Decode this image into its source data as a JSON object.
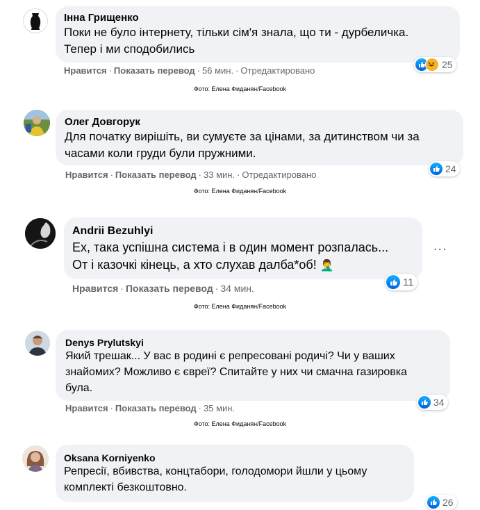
{
  "photo_credit": "Фото: Елена Фиданян/Facebook",
  "actions": {
    "like": "Нравится",
    "translate": "Показать перевод"
  },
  "comments": [
    {
      "author": "Інна Грищенко",
      "lines": [
        "Поки не було інтернету, тільки сім'я знала, що ти - дурбеличка.",
        "Тепер і ми сподобились"
      ],
      "time": "56 мин.",
      "edited": "Отредактировано",
      "reactions": [
        "like-icon",
        "haha-icon"
      ],
      "reaction_count": "25"
    },
    {
      "author": "Олег Довгорук",
      "lines": [
        "Для початку вирішіть, ви сумуєте за цінами, за дитинством чи за",
        "часами коли груди були пружними."
      ],
      "time": "33 мин.",
      "edited": "Отредактировано",
      "reactions": [
        "like-icon"
      ],
      "reaction_count": "24"
    },
    {
      "author": "Andrii Bezuhlyi",
      "lines": [
        "Ех, така успішна система і в один момент розпалась...",
        "От і казочкі кінець, а хто слухав далба*об!"
      ],
      "emoji": "🤦‍♂️",
      "time": "34 мин.",
      "reactions": [
        "like-icon"
      ],
      "reaction_count": "11",
      "more": "..."
    },
    {
      "author": "Denys Prylutskyi",
      "lines": [
        "Який трешак... У вас в родині є репресовані родичі? Чи у ваших",
        "знайомих? Можливо є євреї? Спитайте у них чи смачна газировка",
        "була."
      ],
      "time": "35 мин.",
      "reactions": [
        "like-icon"
      ],
      "reaction_count": "34"
    },
    {
      "author": "Oksana Korniyenko",
      "lines": [
        "Репресії, вбивства, концтабори, голодомори йшли у цьому",
        "комплекті безкоштовно."
      ],
      "reactions": [
        "like-icon"
      ],
      "reaction_count": "26"
    }
  ]
}
